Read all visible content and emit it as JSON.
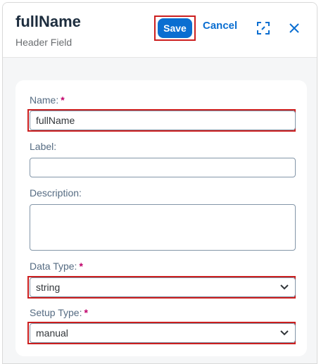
{
  "header": {
    "title": "fullName",
    "subtitle": "Header Field",
    "save_label": "Save",
    "cancel_label": "Cancel",
    "fullscreen_icon": "enter-fullscreen-icon",
    "close_icon": "close-icon"
  },
  "form": {
    "name": {
      "label": "Name:",
      "required": "*",
      "value": "fullName"
    },
    "label_field": {
      "label": "Label:",
      "value": ""
    },
    "description": {
      "label": "Description:",
      "value": ""
    },
    "data_type": {
      "label": "Data Type:",
      "required": "*",
      "value": "string"
    },
    "setup_type": {
      "label": "Setup Type:",
      "required": "*",
      "value": "manual"
    }
  },
  "colors": {
    "accent": "#0a6ed1",
    "highlight": "#cc1f1f",
    "required": "#c0006a"
  }
}
